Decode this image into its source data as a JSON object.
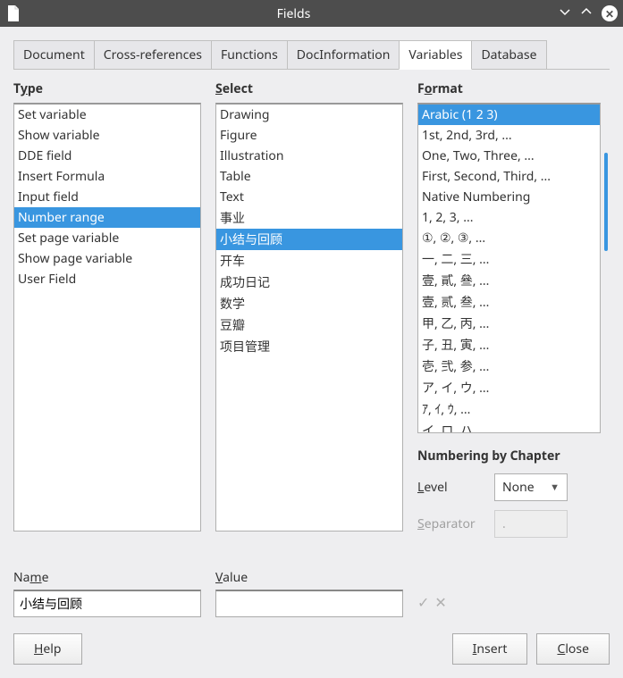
{
  "window": {
    "title": "Fields"
  },
  "tabs": [
    {
      "label": "Document"
    },
    {
      "label": "Cross-references"
    },
    {
      "label": "Functions"
    },
    {
      "label": "DocInformation"
    },
    {
      "label": "Variables",
      "active": true
    },
    {
      "label": "Database"
    }
  ],
  "headers": {
    "type_pre": "T",
    "type_u": "y",
    "type_post": "pe",
    "select_u": "S",
    "select_post": "elect",
    "format_pre": "F",
    "format_u": "o",
    "format_post": "rmat"
  },
  "type_items": [
    "Set variable",
    "Show variable",
    "DDE field",
    "Insert Formula",
    "Input field",
    "Number range",
    "Set page variable",
    "Show page variable",
    "User Field"
  ],
  "type_selected": "Number range",
  "select_items": [
    "Drawing",
    "Figure",
    "Illustration",
    "Table",
    "Text",
    "事业",
    "小结与回顾",
    "开车",
    "成功日记",
    "数学",
    "豆瓣",
    "项目管理"
  ],
  "select_selected": "小结与回顾",
  "format_items": [
    "Arabic (1 2 3)",
    "1st, 2nd, 3rd, ...",
    "One, Two, Three, ...",
    "First, Second, Third, ...",
    "Native Numbering",
    "1, 2, 3, ...",
    "①, ②, ③, ...",
    "一, 二, 三, ...",
    "壹, 貳, 叄, ...",
    "壹, 贰, 叁, ...",
    "甲, 乙, 丙, ...",
    "子, 丑, 寅, ...",
    "壱, 弐, 参, ...",
    "ア, イ, ウ, ...",
    "ｱ, ｲ, ｳ, ...",
    "イ, ロ, ハ, ..."
  ],
  "format_selected": "Arabic (1 2 3)",
  "numbering": {
    "title": "Numbering by Chapter",
    "level_pre": "",
    "level_u": "L",
    "level_post": "evel",
    "level_value": "None",
    "sep_u": "S",
    "sep_post": "eparator",
    "sep_value": "."
  },
  "fields": {
    "name_pre": "Na",
    "name_u": "m",
    "name_post": "e",
    "name_value": "小结与回顾",
    "value_u": "V",
    "value_post": "alue",
    "value_value": ""
  },
  "buttons": {
    "help_u": "H",
    "help_post": "elp",
    "insert_u": "I",
    "insert_post": "nsert",
    "close_u": "C",
    "close_post": "lose"
  }
}
